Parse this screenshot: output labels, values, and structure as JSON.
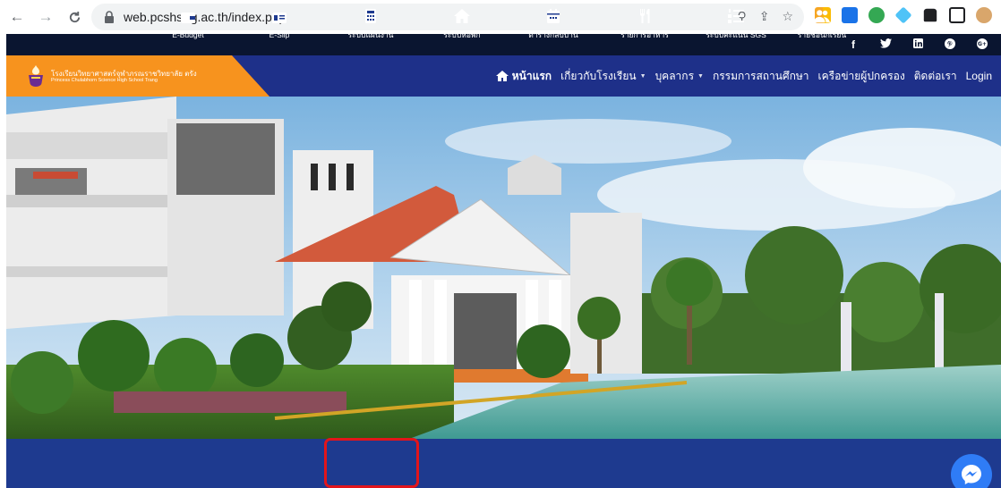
{
  "browser": {
    "url": "web.pcshstrg.ac.th/index.php"
  },
  "site": {
    "logo_th": "โรงเรียนวิทยาศาสตร์จุฬาภรณราชวิทยาลัย ตรัง",
    "logo_en": "Princess Chulabhorn Science High School Trang"
  },
  "social": [
    "f",
    "t",
    "in",
    "p",
    "G+"
  ],
  "menu": [
    {
      "label": "หน้าแรก",
      "active": true
    },
    {
      "label": "เกี่ยวกับโรงเรียน",
      "dropdown": true
    },
    {
      "label": "บุคลากร",
      "dropdown": true
    },
    {
      "label": "กรรมการสถานศึกษา"
    },
    {
      "label": "เครือข่ายผู้ปกครอง"
    },
    {
      "label": "ติดต่อเรา"
    },
    {
      "label": "Login"
    }
  ],
  "quicklinks": [
    {
      "label": "E-Budget",
      "icon": "wallet-icon"
    },
    {
      "label": "E-Slip",
      "icon": "money-slip-icon"
    },
    {
      "label": "ระบบแผนงาน",
      "icon": "calculator-icon"
    },
    {
      "label": "ระบบหอพัก",
      "icon": "home-icon"
    },
    {
      "label": "ตารางกลับบ้าน",
      "icon": "calendar-icon"
    },
    {
      "label": "รายการอาหาร",
      "icon": "utensils-icon"
    },
    {
      "label": "ระบบคะแนน SGS",
      "icon": "ordered-list-icon"
    },
    {
      "label": "รายชื่อนักเรียน",
      "icon": "users-icon"
    }
  ],
  "colors": {
    "header_blue": "#1e3089",
    "quickbar_blue": "#1e3a8f",
    "logo_orange": "#f7931e",
    "highlight_red": "#e3151b"
  }
}
